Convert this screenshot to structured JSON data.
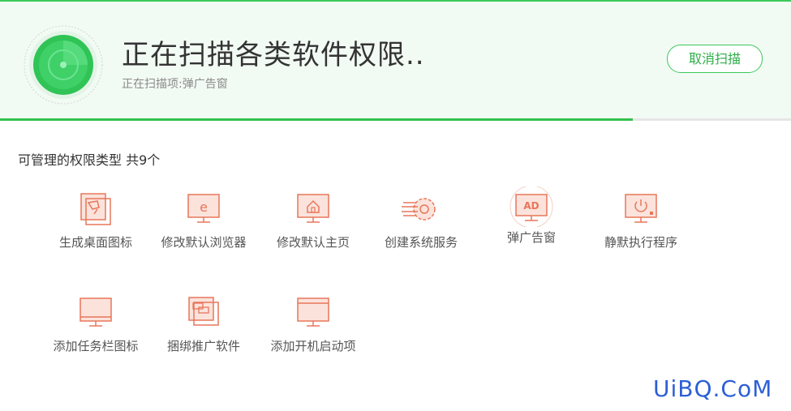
{
  "scan": {
    "title": "正在扫描各类软件权限..",
    "current_item": "正在扫描项:弹广告窗",
    "cancel_label": "取消扫描",
    "progress": 0.8
  },
  "section": {
    "title": "可管理的权限类型 共9个"
  },
  "permissions": [
    {
      "label": "生成桌面图标",
      "icon": "desktop-icon-file-icon"
    },
    {
      "label": "修改默认浏览器",
      "icon": "browser-e-monitor-icon"
    },
    {
      "label": "修改默认主页",
      "icon": "home-monitor-icon"
    },
    {
      "label": "创建系统服务",
      "icon": "system-service-gear-icon"
    },
    {
      "label": "弹广告窗",
      "icon": "ad-monitor-icon"
    },
    {
      "label": "静默执行程序",
      "icon": "power-monitor-icon"
    },
    {
      "label": "添加任务栏图标",
      "icon": "taskbar-monitor-icon"
    },
    {
      "label": "捆绑推广软件",
      "icon": "bundle-software-icon"
    },
    {
      "label": "添加开机启动项",
      "icon": "startup-monitor-icon"
    }
  ],
  "colors": {
    "accent_green": "#3cc95a",
    "icon_orange": "#e8765a"
  },
  "watermark": "UiBQ.CoM"
}
